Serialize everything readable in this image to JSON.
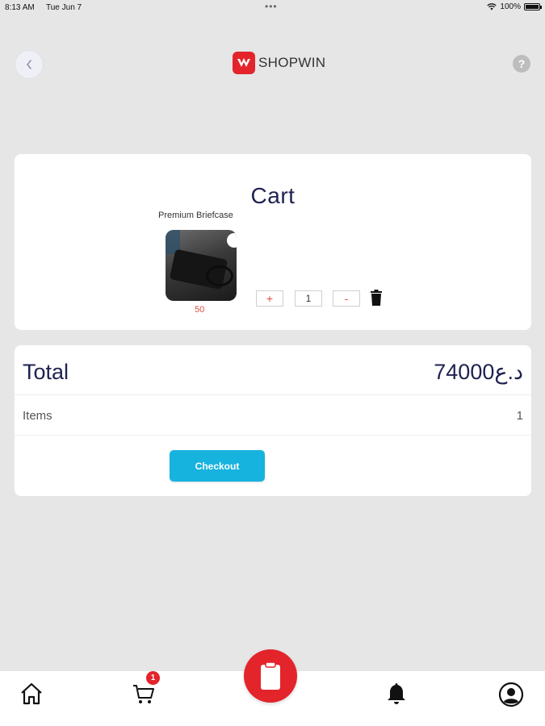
{
  "status_bar": {
    "time": "8:13 AM",
    "date": "Tue Jun 7",
    "battery": "100%",
    "battery_level": 1.0
  },
  "header": {
    "brand": "SHOPWIN",
    "back_icon": "chevron-left-icon",
    "help_icon": "help-icon",
    "help_glyph": "?"
  },
  "cart": {
    "title": "Cart",
    "items": [
      {
        "name": "Premium Briefcase",
        "price": "50",
        "quantity": "1",
        "plus_label": "+",
        "minus_label": "-"
      }
    ]
  },
  "summary": {
    "total_label": "Total",
    "total_value": "74000د.ع",
    "items_label": "Items",
    "items_value": "1",
    "checkout_label": "Checkout"
  },
  "bottom_nav": {
    "cart_badge": "1",
    "items": [
      "home-icon",
      "cart-icon",
      "clipboard-icon",
      "bell-icon",
      "profile-icon"
    ]
  },
  "colors": {
    "brand_red": "#e3242b",
    "accent_blue": "#17b3df",
    "title_navy": "#1e2150",
    "background": "#e6e6e6"
  }
}
